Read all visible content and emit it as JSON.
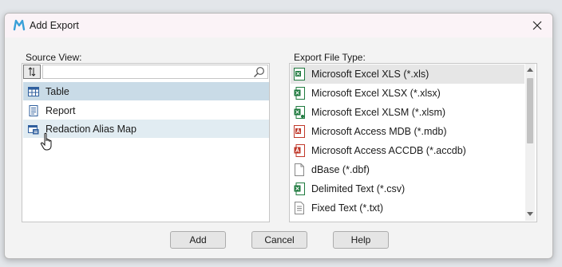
{
  "window": {
    "title": "Add Export"
  },
  "source_view": {
    "label": "Source View:",
    "search": {
      "value": "",
      "placeholder": ""
    },
    "items": [
      {
        "label": "Table",
        "icon": "table-icon",
        "state": "selected"
      },
      {
        "label": "Report",
        "icon": "report-icon",
        "state": "normal"
      },
      {
        "label": "Redaction Alias Map",
        "icon": "alias-map-icon",
        "state": "hover"
      }
    ]
  },
  "export_type": {
    "label": "Export File Type:",
    "items": [
      {
        "label": "Microsoft Excel XLS (*.xls)",
        "icon": "excel-xls-icon",
        "state": "selected"
      },
      {
        "label": "Microsoft Excel XLSX (*.xlsx)",
        "icon": "excel-xlsx-icon",
        "state": "normal"
      },
      {
        "label": "Microsoft Excel XLSM (*.xlsm)",
        "icon": "excel-xlsm-icon",
        "state": "normal"
      },
      {
        "label": "Microsoft Access MDB (*.mdb)",
        "icon": "access-mdb-icon",
        "state": "normal"
      },
      {
        "label": "Microsoft Access ACCDB (*.accdb)",
        "icon": "access-accdb-icon",
        "state": "normal"
      },
      {
        "label": "dBase (*.dbf)",
        "icon": "dbase-file-icon",
        "state": "normal"
      },
      {
        "label": "Delimited Text (*.csv)",
        "icon": "csv-icon",
        "state": "normal"
      },
      {
        "label": "Fixed Text (*.txt)",
        "icon": "text-file-icon",
        "state": "normal"
      }
    ]
  },
  "buttons": {
    "add": "Add",
    "cancel": "Cancel",
    "help": "Help"
  },
  "colors": {
    "selected_row": "#c9dbe7",
    "hover_row": "#e1ecf2",
    "excel_green": "#1f7a3f",
    "access_red": "#c0392b",
    "brand_blue": "#3aa0d8"
  }
}
